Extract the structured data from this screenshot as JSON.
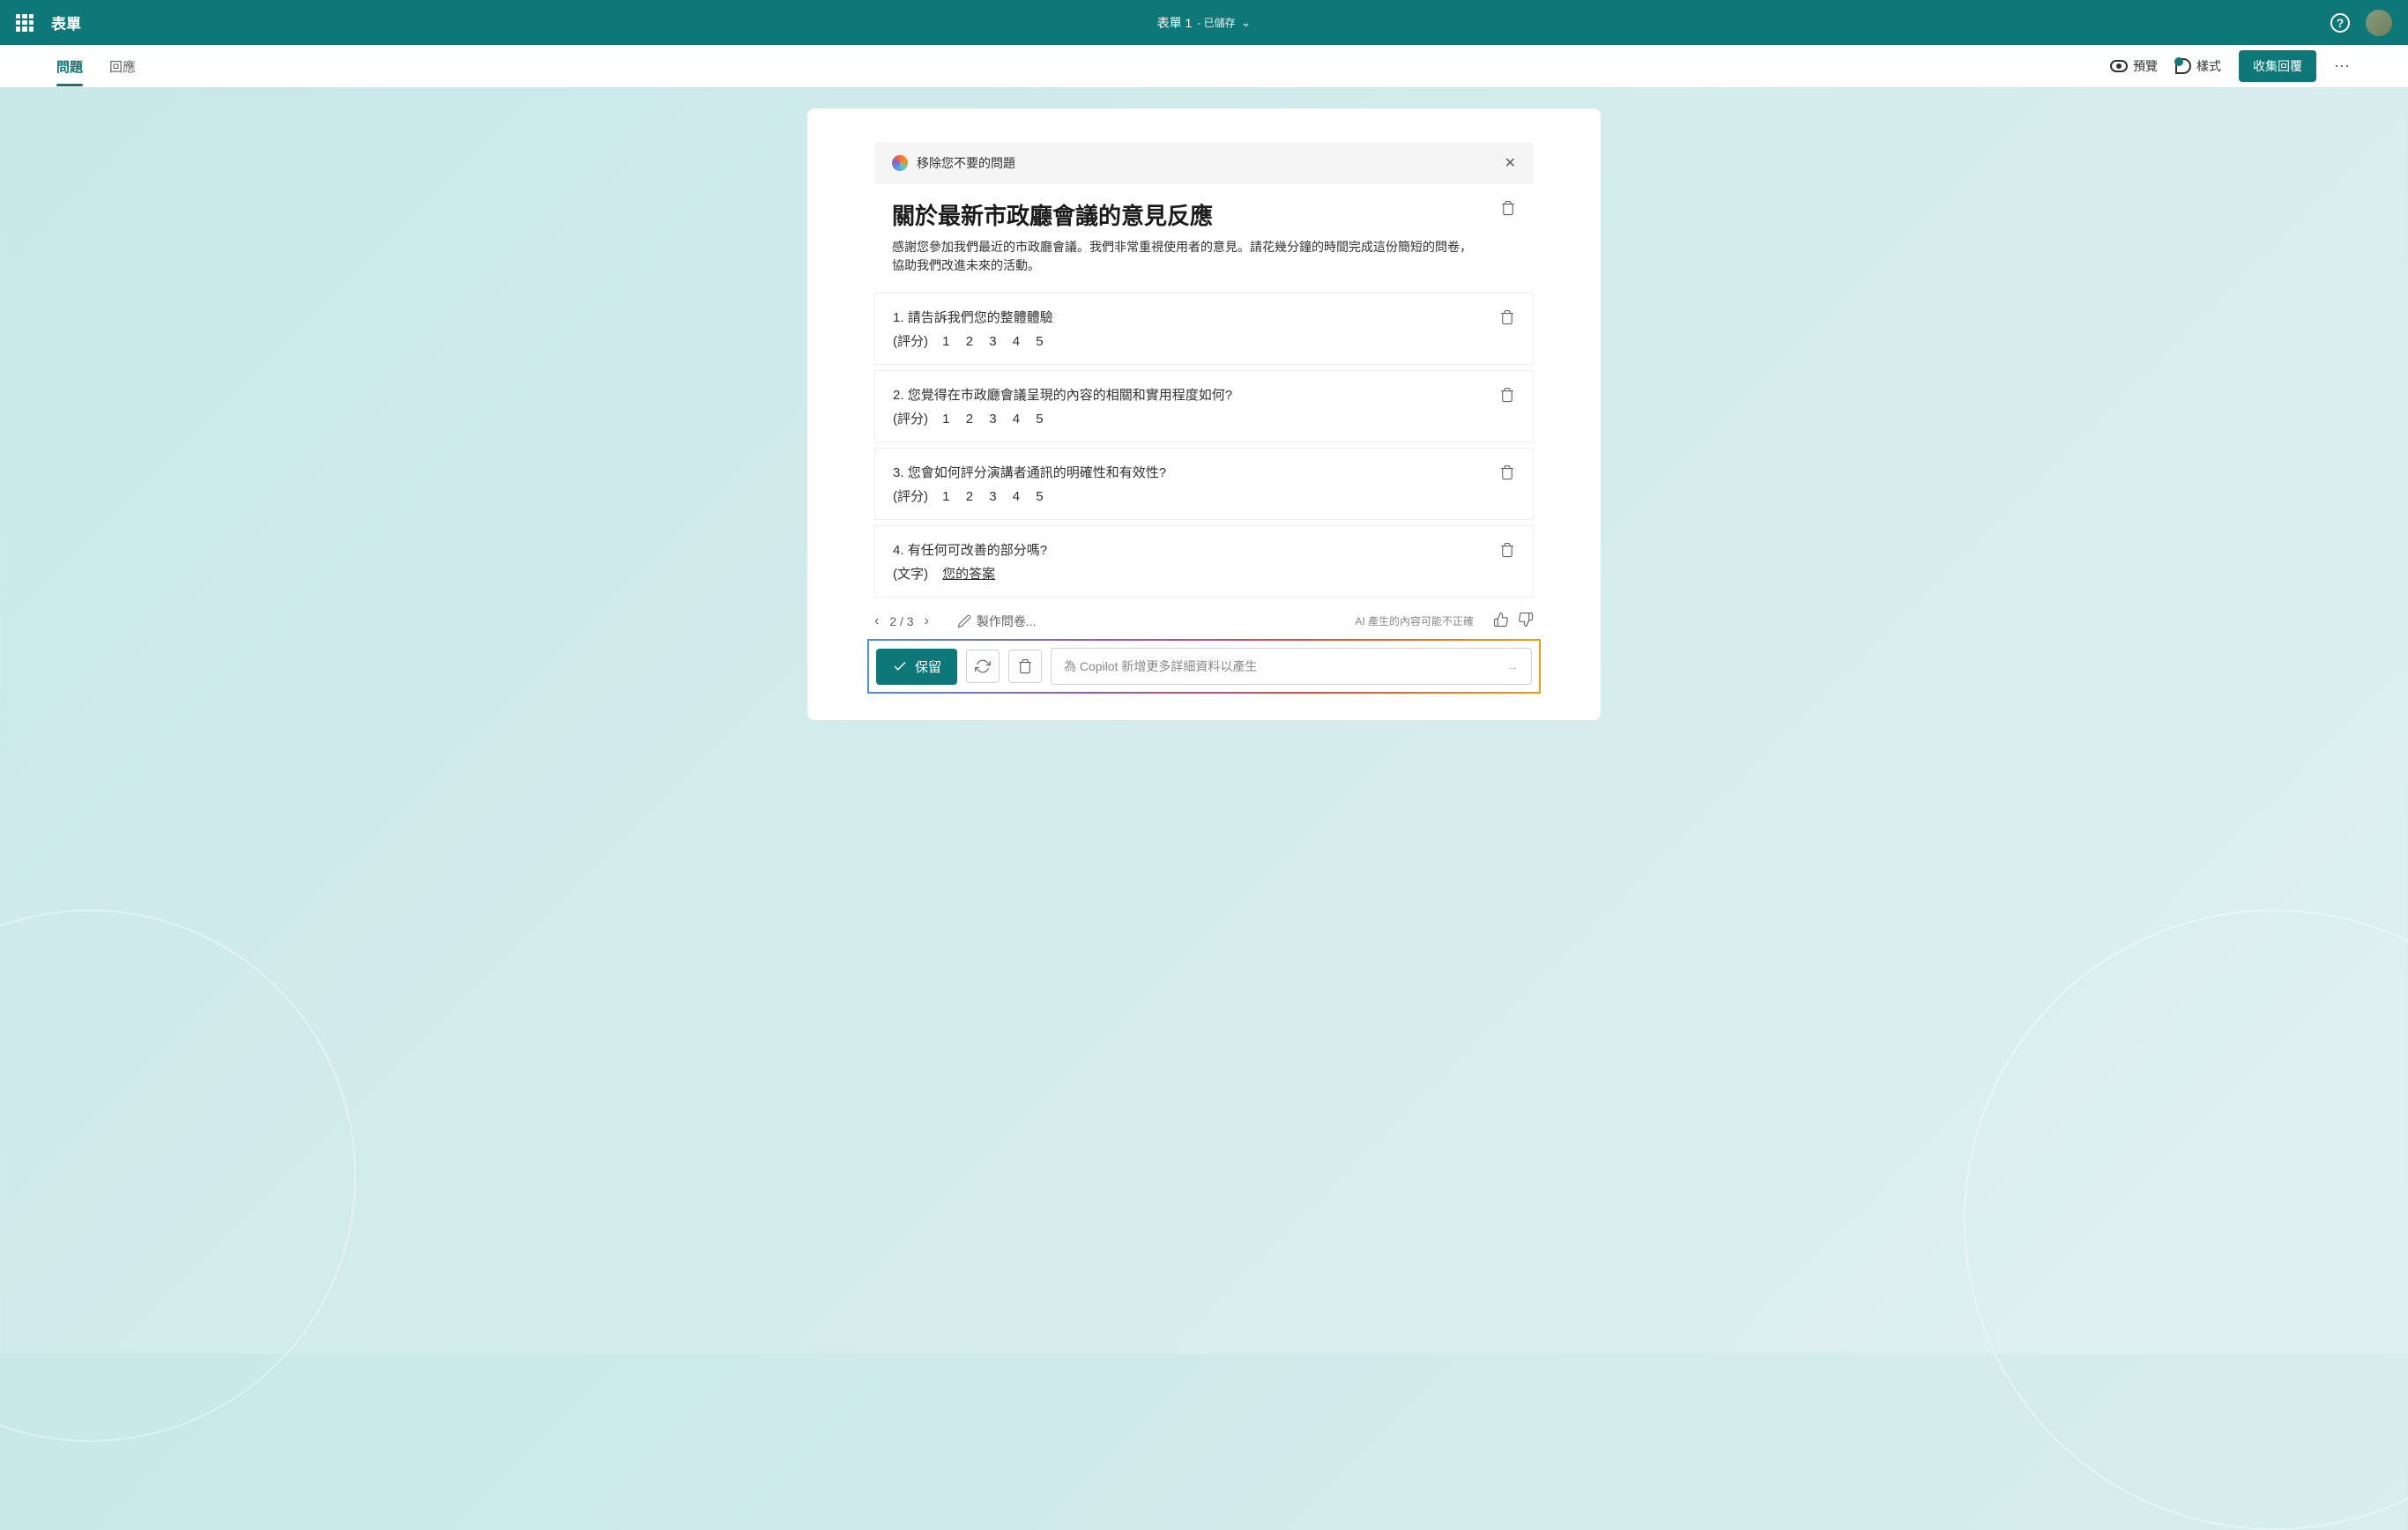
{
  "header": {
    "app_name": "表單",
    "form_name": "表單 1",
    "saved_status": "- 已儲存"
  },
  "tabs": {
    "questions": "問題",
    "responses": "回應"
  },
  "toolbar": {
    "preview": "預覽",
    "style": "樣式",
    "collect": "收集回覆"
  },
  "suggestions": {
    "header_text": "移除您不要的問題",
    "form_title": "關於最新市政廳會議的意見反應",
    "form_desc": "感謝您參加我們最近的市政廳會議。我們非常重視使用者的意見。請花幾分鐘的時間完成這份簡短的問卷，協助我們改進未來的活動。",
    "questions": [
      {
        "num": "1.",
        "text": "請告訴我們您的整體體驗",
        "type": "(評分)",
        "scale": [
          "1",
          "2",
          "3",
          "4",
          "5"
        ]
      },
      {
        "num": "2.",
        "text": "您覺得在市政廳會議呈現的內容的相關和實用程度如何?",
        "type": "(評分)",
        "scale": [
          "1",
          "2",
          "3",
          "4",
          "5"
        ]
      },
      {
        "num": "3.",
        "text": "您會如何評分演講者通訊的明確性和有效性?",
        "type": "(評分)",
        "scale": [
          "1",
          "2",
          "3",
          "4",
          "5"
        ]
      },
      {
        "num": "4.",
        "text": "有任何可改善的部分嗎?",
        "type": "(文字)",
        "answer_placeholder": "您的答案"
      }
    ]
  },
  "pagination": {
    "current": "2",
    "total": "3",
    "draft_label": "製作問卷...",
    "ai_disclaimer": "AI 產生的內容可能不正確"
  },
  "actions": {
    "keep": "保留",
    "copilot_placeholder": "為 Copilot 新增更多詳細資料以產生"
  }
}
